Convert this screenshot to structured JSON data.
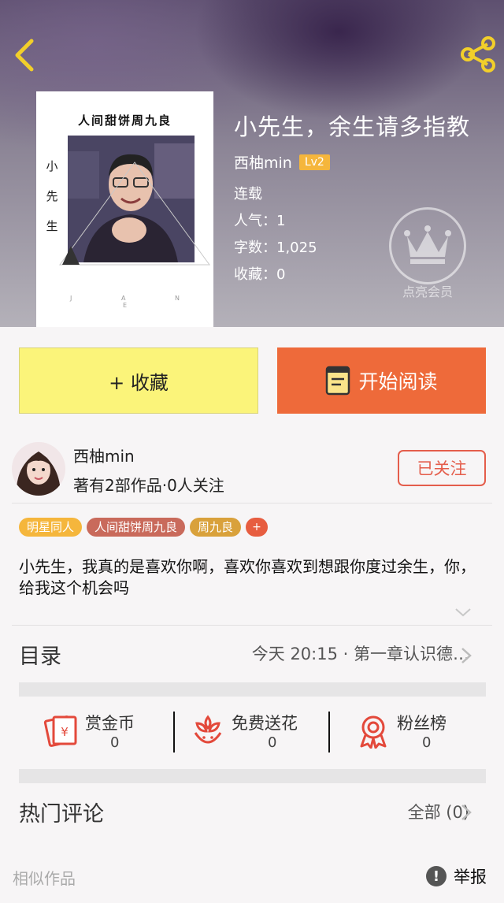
{
  "header": {
    "back_icon": "chevron-left-icon",
    "share_icon": "share-icon"
  },
  "cover": {
    "title": "人间甜饼周九良",
    "side_text": [
      "小",
      "先",
      "生"
    ],
    "footer": "J A N E"
  },
  "book": {
    "title": "小先生，余生请多指教",
    "author": "西柚min",
    "level": "Lv2",
    "status": "连载",
    "popularity": "人气：1",
    "words": "字数：1,025",
    "favorites": "收藏：0",
    "vip_label": "点亮会员"
  },
  "actions": {
    "favorite_label": "+ 收藏",
    "read_label": "开始阅读"
  },
  "author_card": {
    "name": "西柚min",
    "meta": "著有2部作品·0人关注",
    "follow_label": "已关注"
  },
  "tags": [
    {
      "label": "明星同人",
      "color": "#f5b63c"
    },
    {
      "label": "人间甜饼周九良",
      "color": "#c96a5b"
    },
    {
      "label": "周九良",
      "color": "#d9a13b"
    }
  ],
  "tag_add_label": "+",
  "description": "小先生，我真的是喜欢你啊，喜欢你喜欢到想跟你度过余生，你，给我这个机会吗",
  "catalog": {
    "title": "目录",
    "latest": "今天 20:15 · 第一章认识德…"
  },
  "rewards": [
    {
      "label": "赏金币",
      "value": "0",
      "icon": "red-envelope-icon"
    },
    {
      "label": "免费送花",
      "value": "0",
      "icon": "flower-icon"
    },
    {
      "label": "粉丝榜",
      "value": "0",
      "icon": "medal-icon"
    }
  ],
  "comments": {
    "title": "热门评论",
    "all_label": "全部 (0)"
  },
  "footer": {
    "similar_label": "相似作品",
    "report_label": "举报"
  },
  "colors": {
    "accent_yellow": "#fbf47a",
    "accent_orange": "#ee6a3a",
    "follow_red": "#e45d4b",
    "level_badge": "#f5b63c"
  }
}
